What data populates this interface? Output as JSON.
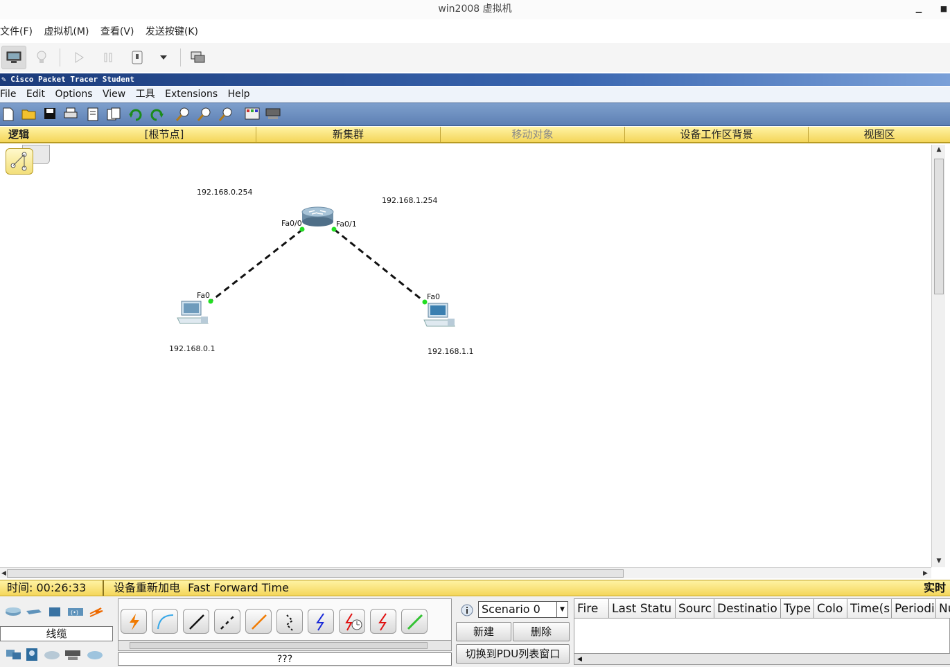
{
  "vm": {
    "title": "win2008 虚拟机",
    "minimize_glyph": "▁",
    "close_glyph": "■",
    "menu": [
      "文件(F)",
      "虚拟机(M)",
      "查看(V)",
      "发送按键(K)"
    ]
  },
  "pt": {
    "title": "Cisco Packet Tracer Student",
    "menu": [
      "File",
      "Edit",
      "Options",
      "View",
      "工具",
      "Extensions",
      "Help"
    ]
  },
  "workspace_bar": {
    "tab": "逻辑",
    "root": "[根节点]",
    "new_cluster": "新集群",
    "move_object": "移动对象",
    "set_background": "设备工作区背景",
    "viewport": "视图区"
  },
  "topology": {
    "router": {
      "port_left": "Fa0/0",
      "port_right": "Fa0/1",
      "ip_left": "192.168.0.254",
      "ip_right": "192.168.1.254"
    },
    "pc_left": {
      "port": "Fa0",
      "ip": "192.168.0.1"
    },
    "pc_right": {
      "port": "Fa0",
      "ip": "192.168.1.1"
    }
  },
  "status": {
    "time": "时间: 00:26:33",
    "power_cycle": "设备重新加电",
    "fast_forward": "Fast Forward Time",
    "mode": "实时"
  },
  "bottom": {
    "category_label": "线缆",
    "cable_name": "???",
    "scenario": "Scenario 0",
    "new_button": "新建",
    "delete_button": "删除",
    "toggle_pdu": "切换到PDU列表窗口",
    "pdu_columns": [
      "Fire",
      "Last Statu",
      "Sourc",
      "Destinatio",
      "Type",
      "Colo",
      "Time(s",
      "Periodi",
      "Nu"
    ]
  },
  "colors": {
    "workspace_bar": "#f4d65a",
    "pt_toolbar": "#5d80b4",
    "link_dot": "#22dd22"
  }
}
